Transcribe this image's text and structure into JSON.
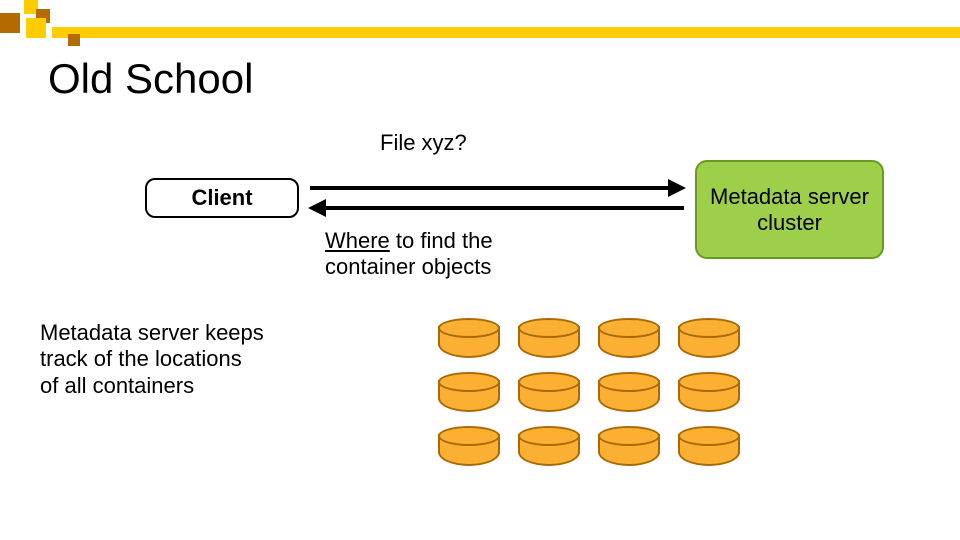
{
  "title": "Old School",
  "query_label": "File xyz?",
  "client_label": "Client",
  "server_label": "Metadata server cluster",
  "response_line1": "Where to find the",
  "response_line2": "container objects",
  "note_line1": "Metadata server keeps",
  "note_line2": "track of the locations",
  "note_line3": "of all containers",
  "containers": {
    "rows": 3,
    "cols": 4
  },
  "colors": {
    "accent": "#ffcc00",
    "accent_dark": "#b36b00",
    "server_fill": "#9ecf4a",
    "cyl_fill": "#fbb034"
  }
}
